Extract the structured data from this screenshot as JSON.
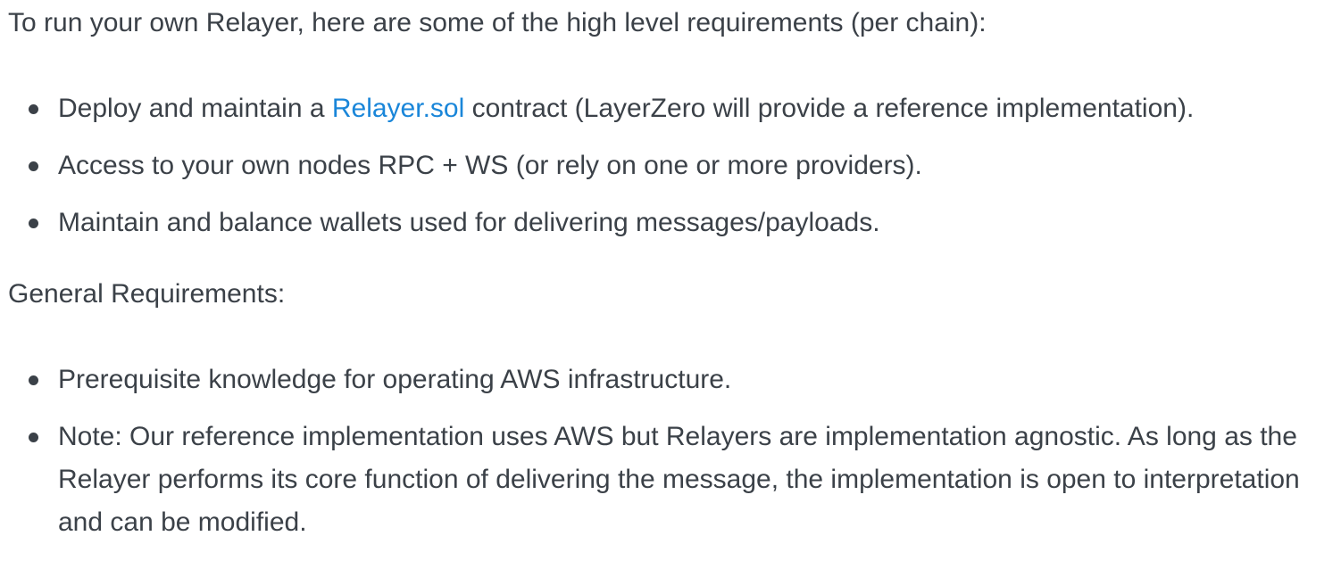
{
  "intro": "To run your own Relayer, here are some of the high level requirements (per chain):",
  "chain_requirements": [
    {
      "before": "Deploy and maintain a ",
      "link": "Relayer.sol",
      "after": " contract (LayerZero will provide a reference implementation)."
    },
    {
      "text": "Access to your own nodes RPC + WS (or rely on one or more providers)."
    },
    {
      "text": "Maintain and balance wallets used for delivering messages/payloads."
    }
  ],
  "general_heading": "General Requirements:",
  "general_requirements": [
    {
      "text": "Prerequisite knowledge for operating AWS infrastructure."
    },
    {
      "text": "Note: Our reference implementation uses AWS but Relayers are implementation agnostic. As long as the Relayer performs its core function of delivering the message, the implementation is open to interpretation and can be modified."
    }
  ],
  "colors": {
    "text": "#3b4148",
    "link": "#1a86d9"
  }
}
